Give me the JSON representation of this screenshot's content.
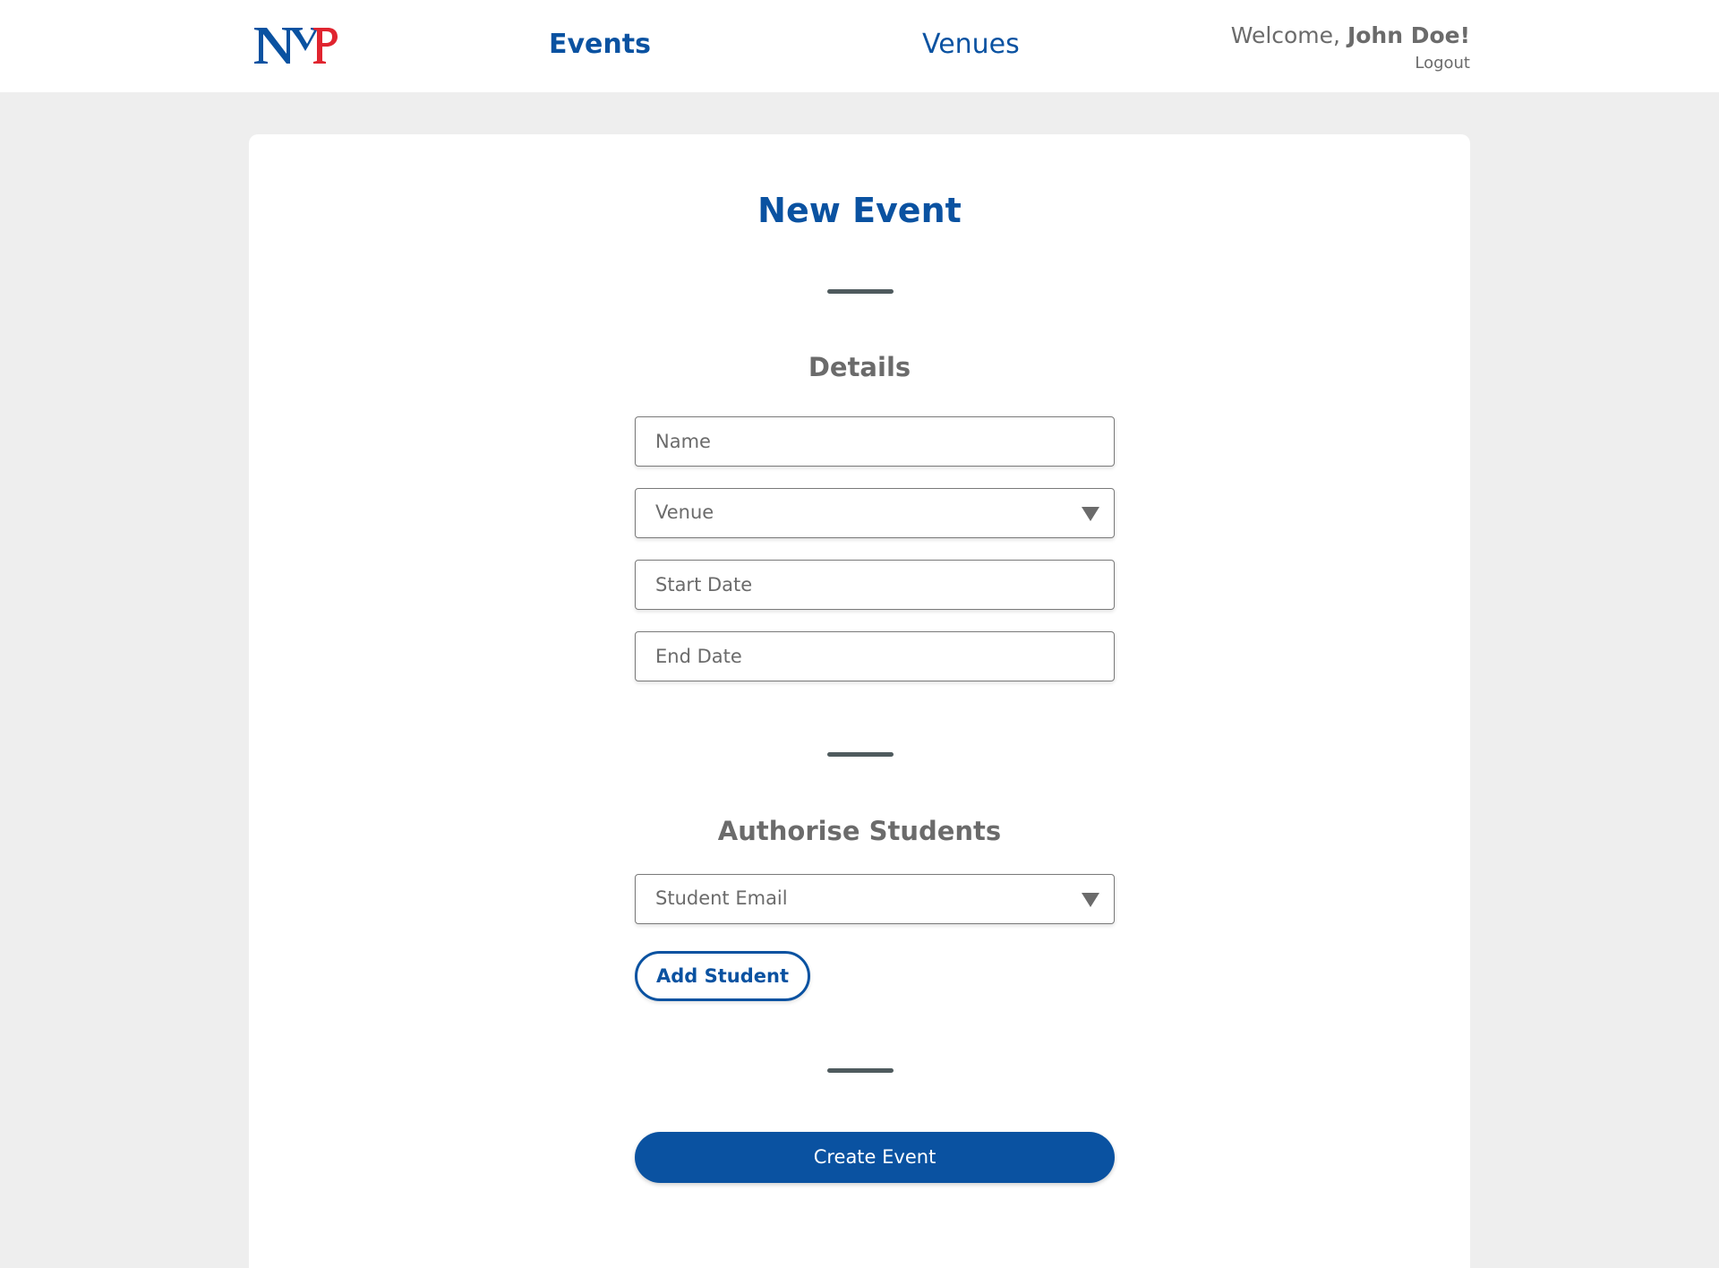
{
  "header": {
    "logo_text": "NYP",
    "nav": {
      "events_label": "Events",
      "venues_label": "Venues"
    },
    "user": {
      "welcome_prefix": "Welcome, ",
      "name": "John Doe!",
      "logout_label": "Logout"
    }
  },
  "form": {
    "title": "New Event",
    "details": {
      "heading": "Details",
      "name_placeholder": "Name",
      "venue_label": "Venue",
      "start_date_placeholder": "Start Date",
      "end_date_placeholder": "End Date"
    },
    "students": {
      "heading": "Authorise Students",
      "email_label": "Student Email",
      "add_button_label": "Add Student"
    },
    "submit_label": "Create Event"
  },
  "colors": {
    "brand_blue": "#0a52a1",
    "logo_red": "#e0242f",
    "page_bg": "#eeeeee",
    "divider": "#4f5b5e"
  },
  "icons": {
    "select_caret": "chevron-down-icon"
  }
}
